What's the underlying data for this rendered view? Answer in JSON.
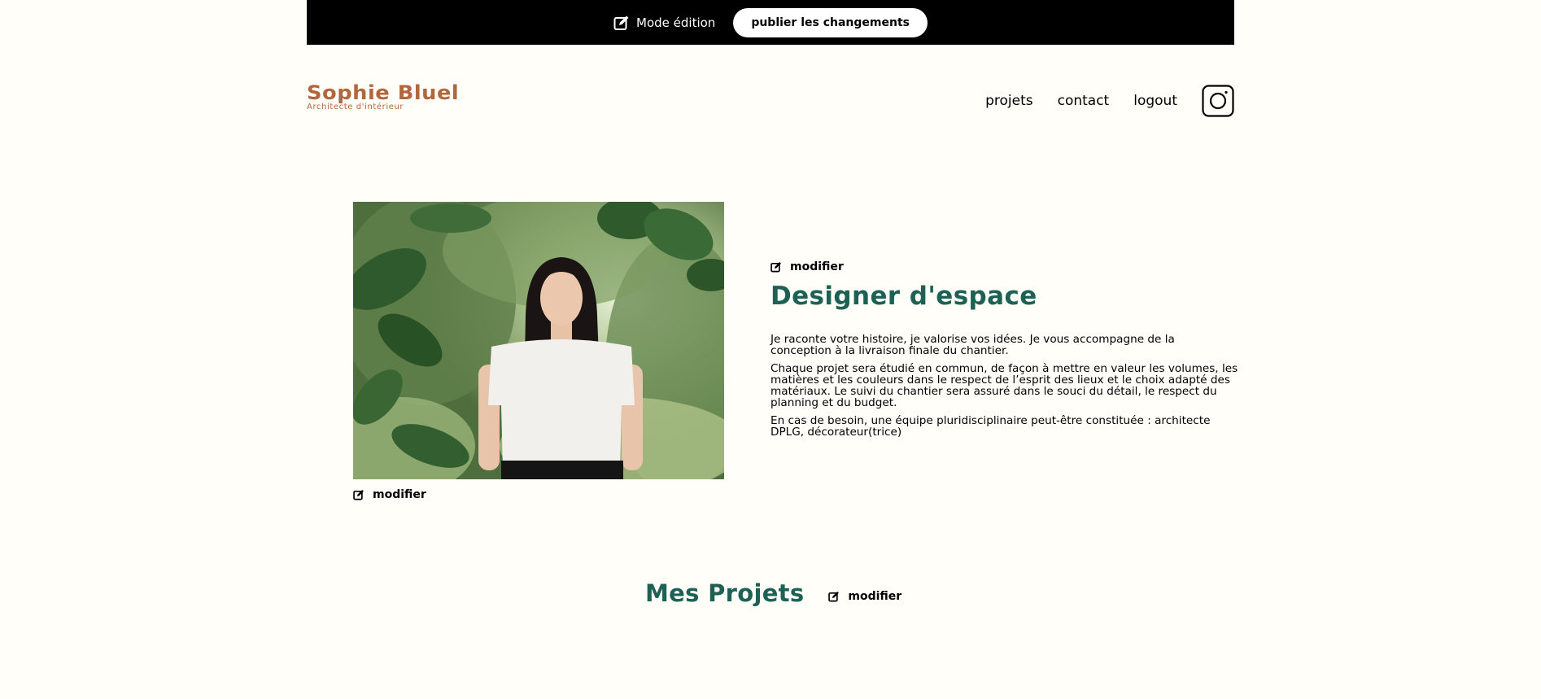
{
  "edit_bar": {
    "mode_label": "Mode édition",
    "publish_label": "publier les changements",
    "icon": "edit-icon"
  },
  "header": {
    "logo_name": "Sophie Bluel",
    "logo_subtitle": "Architecte d'intérieur",
    "nav": [
      "projets",
      "contact",
      "logout"
    ],
    "instagram_icon": "instagram-icon"
  },
  "introduction": {
    "photo_modify_label": "modifier",
    "text_modify_label": "modifier",
    "title": "Designer d'espace",
    "paragraphs": [
      "Je raconte votre histoire, je valorise vos idées. Je vous accompagne de la conception à la livraison finale du chantier.",
      "Chaque projet sera étudié en commun, de façon à mettre en valeur les volumes, les matières et les couleurs dans le respect de l’esprit des lieux et le choix adapté des matériaux. Le suivi du chantier sera assuré dans le souci du détail, le respect du planning et du budget.",
      "En cas de besoin, une équipe pluridisciplinaire peut-être constituée : architecte DPLG, décorateur(trice)"
    ]
  },
  "projects": {
    "title": "Mes Projets",
    "modify_label": "modifier"
  },
  "colors": {
    "accent_green": "#1D6154",
    "brand_brown": "#B1663C",
    "background": "#FFFEF8",
    "edit_bar": "#000000"
  }
}
